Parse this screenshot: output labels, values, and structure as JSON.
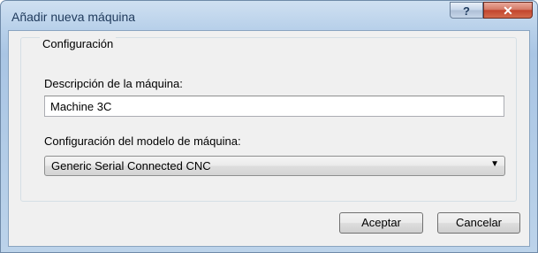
{
  "window": {
    "title": "Añadir nueva máquina",
    "help_glyph": "?",
    "close_glyph": "✕"
  },
  "group": {
    "title": "Configuración",
    "description_label": "Descripción de la máquina:",
    "description_value": "Machine 3C",
    "model_label": "Configuración del modelo de máquina:",
    "model_value": "Generic Serial Connected CNC",
    "dropdown_glyph": "▼"
  },
  "buttons": {
    "accept": "Aceptar",
    "cancel": "Cancelar"
  },
  "icons": {
    "help": "question-mark-icon",
    "close": "close-icon",
    "dropdown": "chevron-down-icon"
  },
  "colors": {
    "title_text": "#1e395b",
    "close_button": "#c2452d"
  }
}
